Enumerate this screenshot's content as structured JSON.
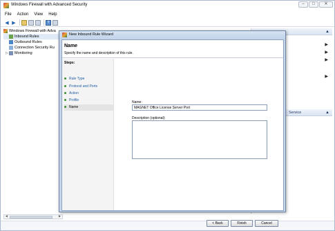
{
  "window": {
    "title": "Windows Firewall with Advanced Security",
    "controls": {
      "minimize": "–",
      "maximize": "□",
      "close": "✕"
    }
  },
  "menu": [
    "File",
    "Action",
    "View",
    "Help"
  ],
  "tree": {
    "root": "Windows Firewall with Adva",
    "items": [
      "Inbound Rules",
      "Outbound Rules",
      "Connection Security Ru",
      "Monitoring"
    ]
  },
  "scroll": {
    "left": "◄",
    "right": "►"
  },
  "actions": {
    "header_arrow": "▲",
    "arrows": [
      "▶",
      "▶",
      "▶",
      "▶"
    ],
    "service_label": "Service",
    "service_arrow": "▲"
  },
  "wizard": {
    "title": "New Inbound Rule Wizard",
    "heading": "Name",
    "subheading": "Specify the name and description of this rule.",
    "steps_label": "Steps:",
    "steps": [
      "Rule Type",
      "Protocol and Ports",
      "Action",
      "Profile",
      "Name"
    ],
    "current_step": "Name",
    "name_label": "Name:",
    "name_value": "MAGNET Office License Server Port",
    "description_label": "Description (optional):",
    "description_value": "",
    "buttons": {
      "back": "< Back",
      "finish": "Finish",
      "cancel": "Cancel"
    }
  }
}
